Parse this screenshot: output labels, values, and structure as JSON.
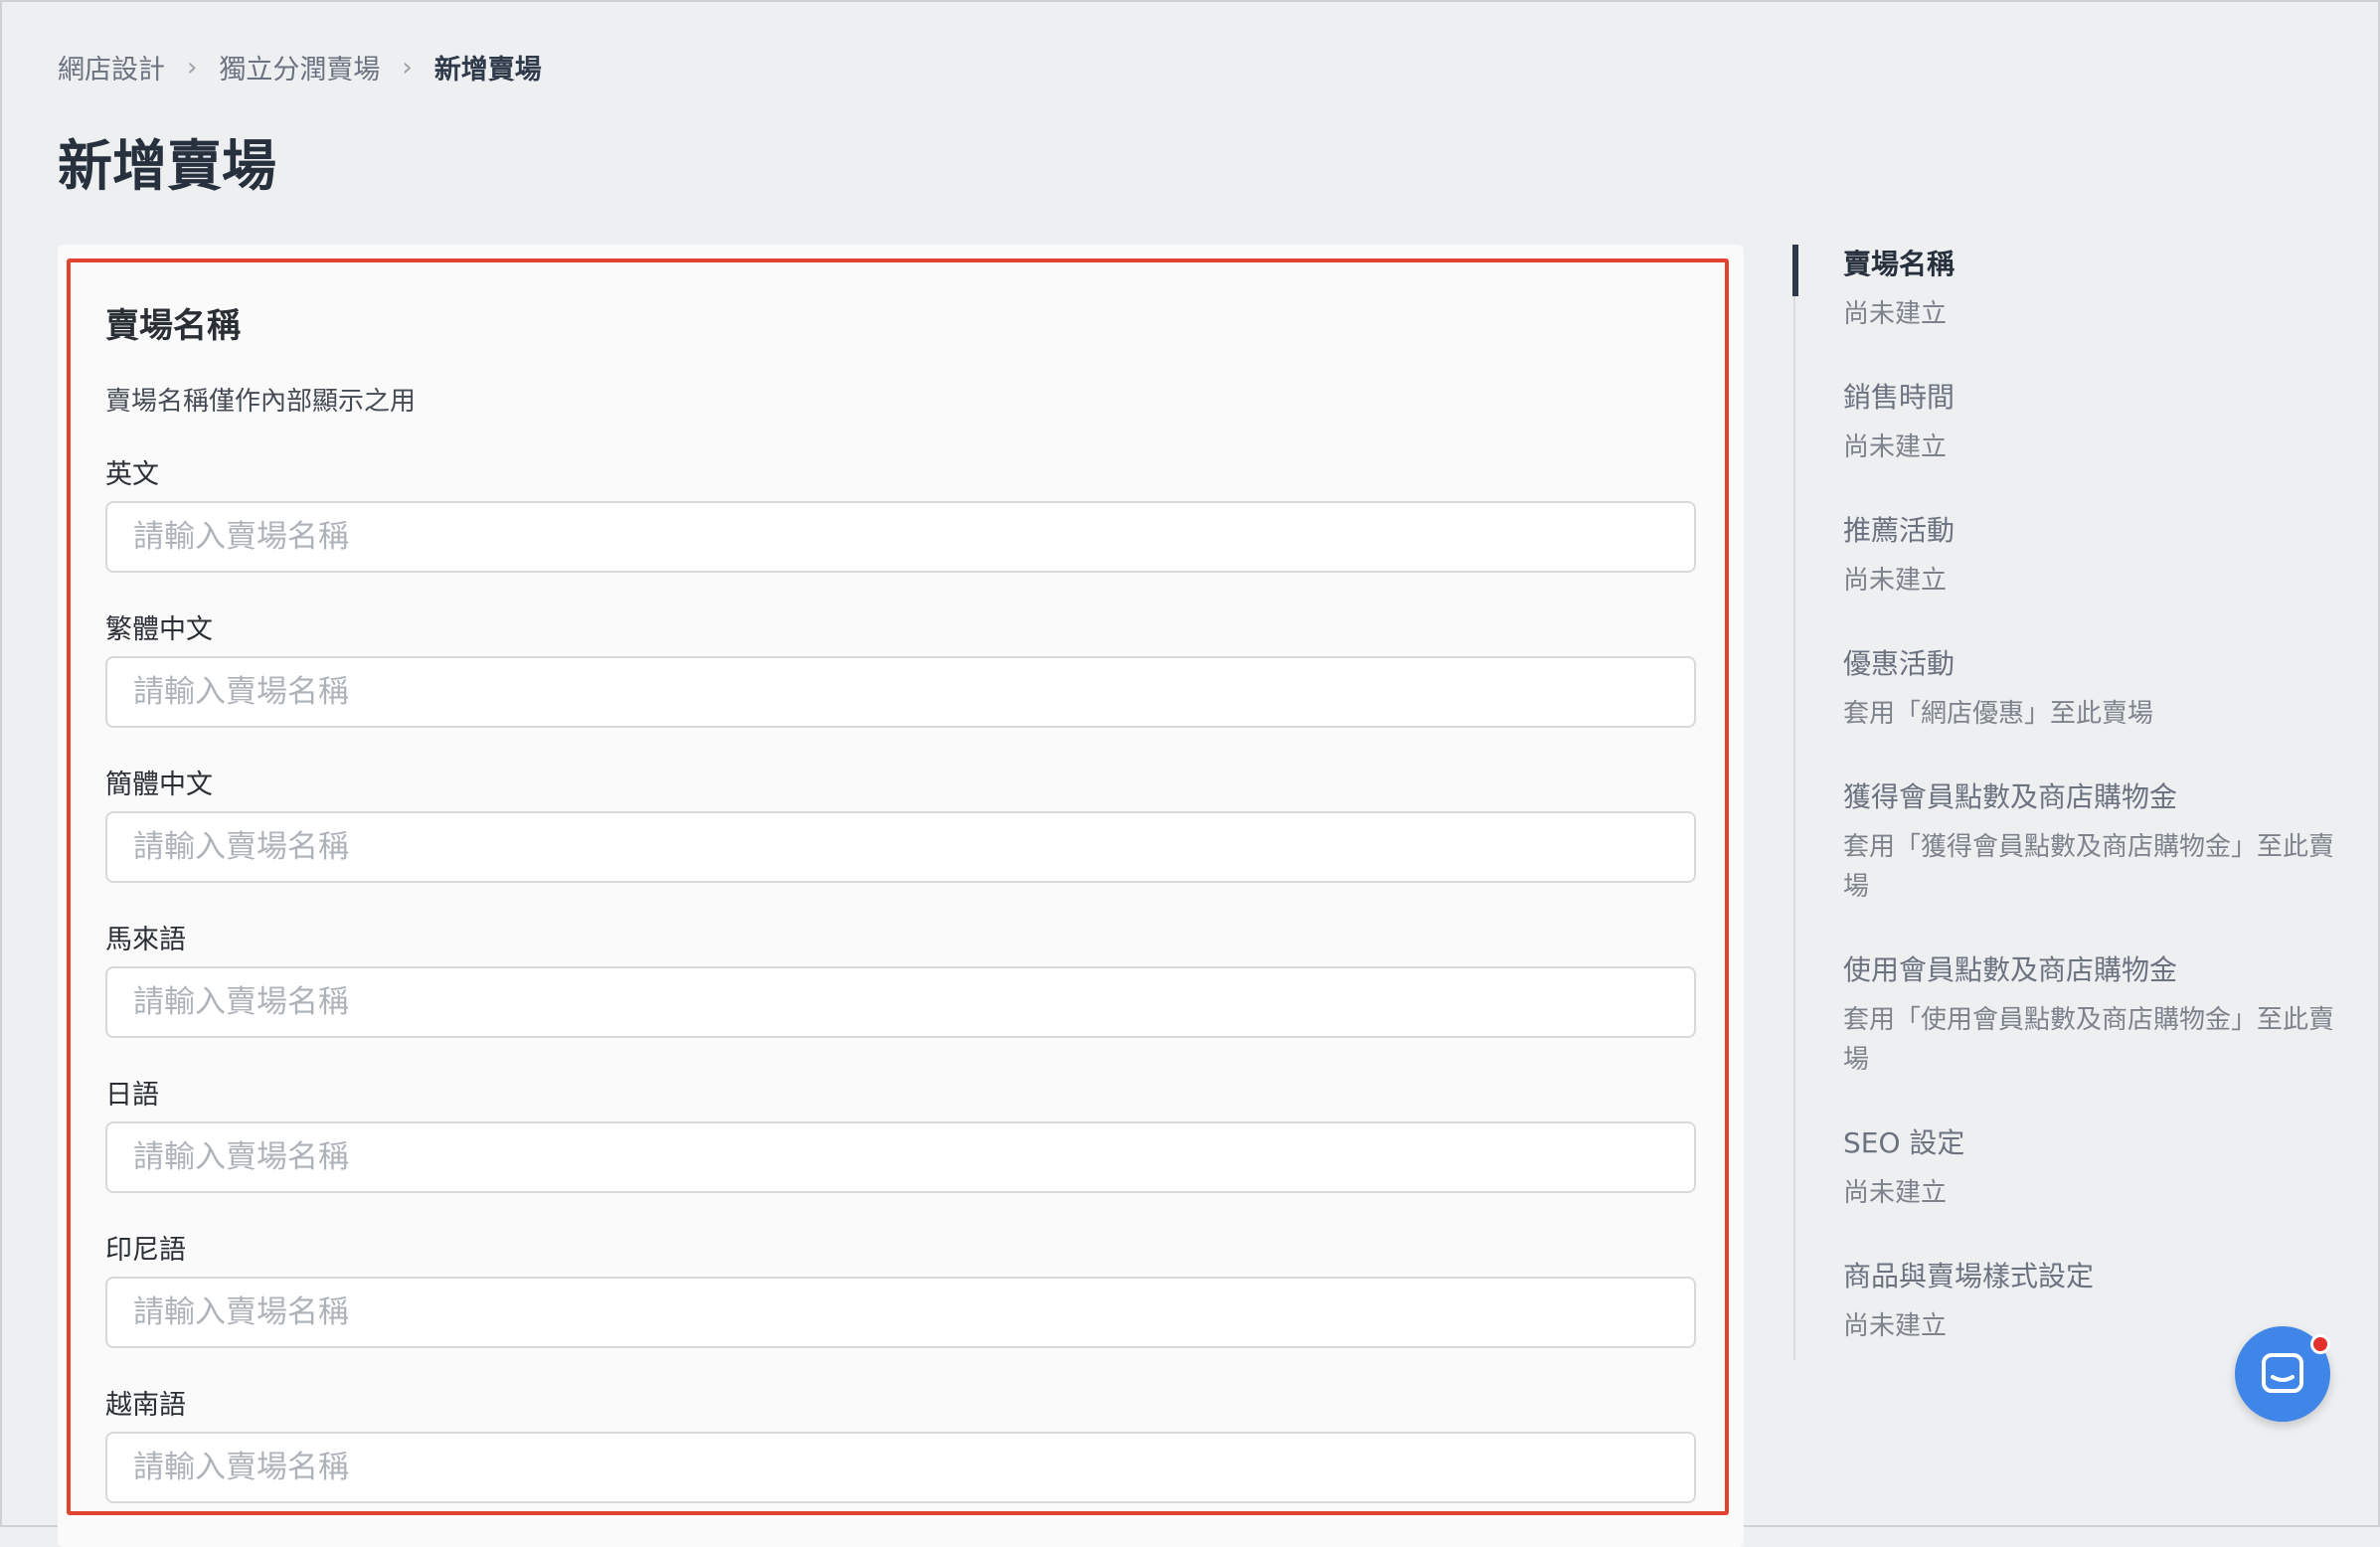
{
  "breadcrumb": {
    "items": [
      "網店設計",
      "獨立分潤賣場"
    ],
    "current": "新增賣場"
  },
  "page": {
    "title": "新增賣場"
  },
  "form": {
    "section_title": "賣場名稱",
    "section_desc": "賣場名稱僅作內部顯示之用",
    "placeholder": "請輸入賣場名稱",
    "fields": [
      {
        "label": "英文",
        "value": ""
      },
      {
        "label": "繁體中文",
        "value": ""
      },
      {
        "label": "簡體中文",
        "value": ""
      },
      {
        "label": "馬來語",
        "value": ""
      },
      {
        "label": "日語",
        "value": ""
      },
      {
        "label": "印尼語",
        "value": ""
      },
      {
        "label": "越南語",
        "value": ""
      }
    ]
  },
  "side_nav": {
    "items": [
      {
        "title": "賣場名稱",
        "sub": "尚未建立",
        "active": true
      },
      {
        "title": "銷售時間",
        "sub": "尚未建立"
      },
      {
        "title": "推薦活動",
        "sub": "尚未建立"
      },
      {
        "title": "優惠活動",
        "sub": "套用「網店優惠」至此賣場"
      },
      {
        "title": "獲得會員點數及商店購物金",
        "sub": "套用「獲得會員點數及商店購物金」至此賣場"
      },
      {
        "title": "使用會員點數及商店購物金",
        "sub": "套用「使用會員點數及商店購物金」至此賣場"
      },
      {
        "title": "SEO 設定",
        "sub": "尚未建立"
      },
      {
        "title": "商品與賣場樣式設定",
        "sub": "尚未建立"
      }
    ]
  },
  "chat": {
    "icon": "chat-bubble-icon",
    "button_color": "#3f86e8",
    "badge_color": "#e5302d"
  },
  "colors": {
    "highlight_border": "#e0432f",
    "background": "#eeeff1"
  }
}
